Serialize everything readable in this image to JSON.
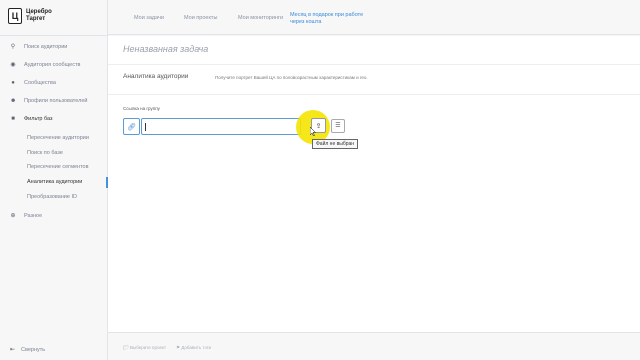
{
  "logo": {
    "glyph": "Ц",
    "line1": "Церебро",
    "line2": "Таргет"
  },
  "sidebar": {
    "items": [
      {
        "label": "Поиск аудитории",
        "icon": "search-icon"
      },
      {
        "label": "Аудитория сообществ",
        "icon": "target-icon"
      },
      {
        "label": "Сообщества",
        "icon": "chat-icon"
      },
      {
        "label": "Профили пользователей",
        "icon": "users-icon"
      },
      {
        "label": "Фильтр баз",
        "icon": "filter-icon"
      }
    ],
    "subitems": [
      {
        "label": "Пересечение аудитории"
      },
      {
        "label": "Поиск по базе"
      },
      {
        "label": "Пересечение сегментов"
      },
      {
        "label": "Аналитика аудитории"
      },
      {
        "label": "Преобразование ID"
      }
    ],
    "misc": {
      "label": "Разное",
      "icon": "plus-circle-icon"
    },
    "collapse": {
      "label": "Свернуть",
      "icon": "arrow-left-icon"
    }
  },
  "topnav": {
    "tabs": [
      "Мои задачи",
      "Мои проекты",
      "Мои мониторинги"
    ],
    "promo": "Месяц в подарок при работе через кошта"
  },
  "main": {
    "task_title": "Неназванная задача",
    "section_title": "Аналитика аудитории",
    "section_desc": "Получите портрет Вашей ЦА по половозрастным характеристикам и гео.",
    "link_label": "Ссылка на группу",
    "tooltip": "Файл не выбран"
  },
  "bottom": {
    "select_project": "Выберите проект",
    "add_tag": "Добавить тэги"
  },
  "colors": {
    "accent": "#4a90d9",
    "highlight": "#f4e400"
  }
}
